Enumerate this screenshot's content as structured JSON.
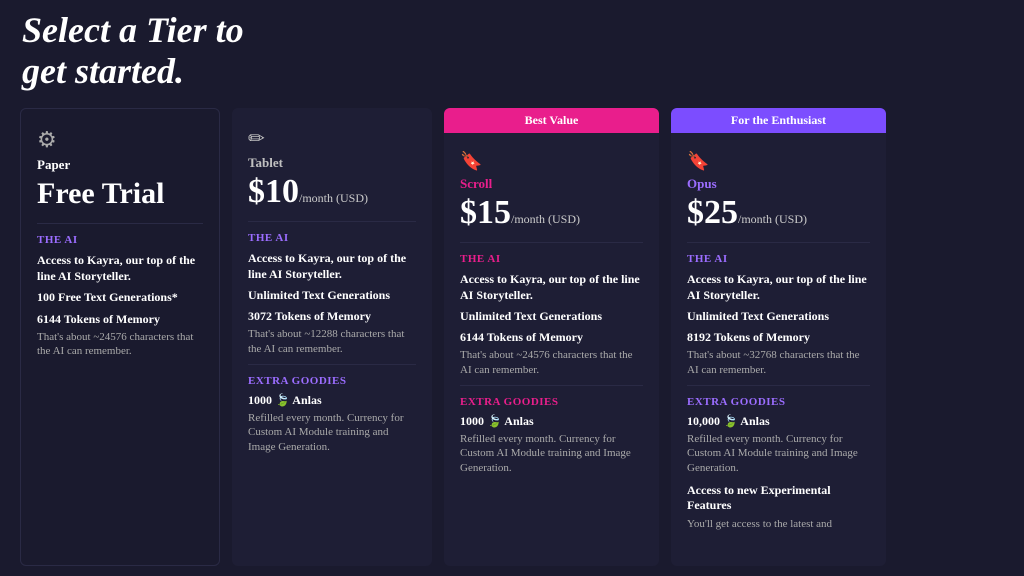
{
  "header": {
    "title_line1": "Select a Tier to",
    "title_line2": "get started."
  },
  "cards": {
    "paper": {
      "icon": "⚙",
      "name": "Paper",
      "price": "Free Trial",
      "the_ai_label": "The AI",
      "ai_description": "Access to Kayra, our top of the line AI Storyteller.",
      "feature1": "100 Free Text Generations*",
      "feature2": "6144 Tokens of Memory",
      "feature2_sub": "That's about ~24576 characters that the AI can remember."
    },
    "tablet": {
      "icon": "✏",
      "name": "Tablet",
      "price": "$10",
      "period": "/month (USD)",
      "the_ai_label": "The AI",
      "ai_description": "Access to Kayra, our top of the line AI Storyteller.",
      "feature1": "Unlimited Text Generations",
      "feature2": "3072 Tokens of Memory",
      "feature2_sub": "That's about ~12288 characters that the AI can remember.",
      "extra_goodies_label": "Extra Goodies",
      "anlas": "1000 🍃 Anlas",
      "anlas_sub": "Refilled every month. Currency for Custom AI Module training and Image Generation."
    },
    "scroll": {
      "badge": "Best Value",
      "icon": "🔖",
      "name": "Scroll",
      "price": "$15",
      "period": "/month (USD)",
      "the_ai_label": "The AI",
      "ai_description": "Access to Kayra, our top of the line AI Storyteller.",
      "feature1": "Unlimited Text Generations",
      "feature2": "6144 Tokens of Memory",
      "feature2_sub": "That's about ~24576 characters that the AI can remember.",
      "extra_goodies_label": "Extra Goodies",
      "anlas": "1000 🍃 Anlas",
      "anlas_sub": "Refilled every month. Currency for Custom AI Module training and Image Generation."
    },
    "opus": {
      "badge": "For the Enthusiast",
      "icon": "🔖",
      "name": "Opus",
      "price": "$25",
      "period": "/month (USD)",
      "the_ai_label": "The AI",
      "ai_description": "Access to Kayra, our top of the line AI Storyteller.",
      "feature1": "Unlimited Text Generations",
      "feature2": "8192 Tokens of Memory",
      "feature2_sub": "That's about ~32768 characters that the AI can remember.",
      "extra_goodies_label": "Extra Goodies",
      "anlas": "10,000 🍃 Anlas",
      "anlas_sub": "Refilled every month. Currency for Custom AI Module training and Image Generation.",
      "experimental_label": "Access to new Experimental Features",
      "experimental_sub": "You'll get access to the latest and"
    }
  }
}
